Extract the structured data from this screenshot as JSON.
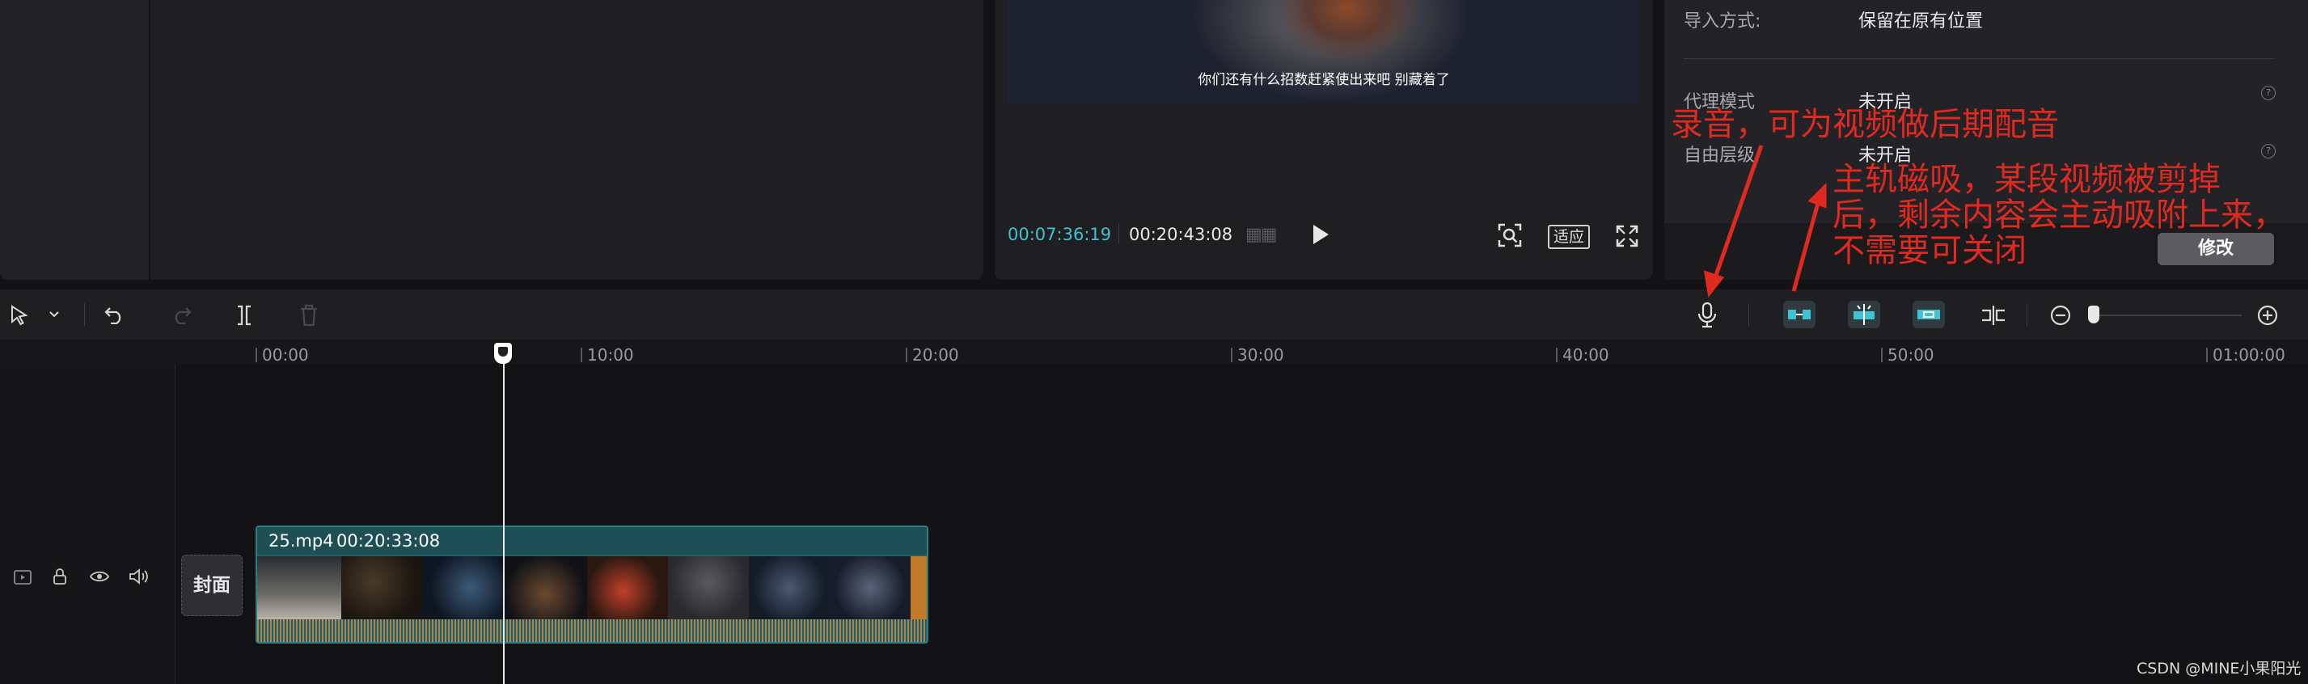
{
  "player": {
    "subtitle": "你们还有什么招数赶紧使出来吧  别藏着了",
    "time_current": "00:07:36:19",
    "time_total": "00:20:43:08",
    "fit_label": "适应"
  },
  "properties": {
    "import_mode_label": "导入方式:",
    "import_mode_value": "保留在原有位置",
    "proxy_label": "代理模式",
    "proxy_value": "未开启",
    "free_layer_label": "自由层级",
    "free_layer_value": "未开启",
    "help_glyph": "?",
    "modify_label": "修改"
  },
  "ruler": {
    "ticks": [
      "00:00",
      "10:00",
      "20:00",
      "30:00",
      "40:00",
      "50:00",
      "01:00:00"
    ]
  },
  "timeline": {
    "cover_label": "封面",
    "clip_name": "25.mp4",
    "clip_duration": "00:20:33:08"
  },
  "annotations": {
    "record": "录音，可为视频做后期配音",
    "magnet_line1": "主轨磁吸，某段视频被剪掉",
    "magnet_line2": "后，剩余内容会主动吸附上来，",
    "magnet_line3": "不需要可关闭"
  },
  "watermark": "CSDN @MINE小果阳光",
  "colors": {
    "accent_time": "#3ec2d4",
    "annotation": "#e02a20",
    "clip": "#1f5f66"
  }
}
